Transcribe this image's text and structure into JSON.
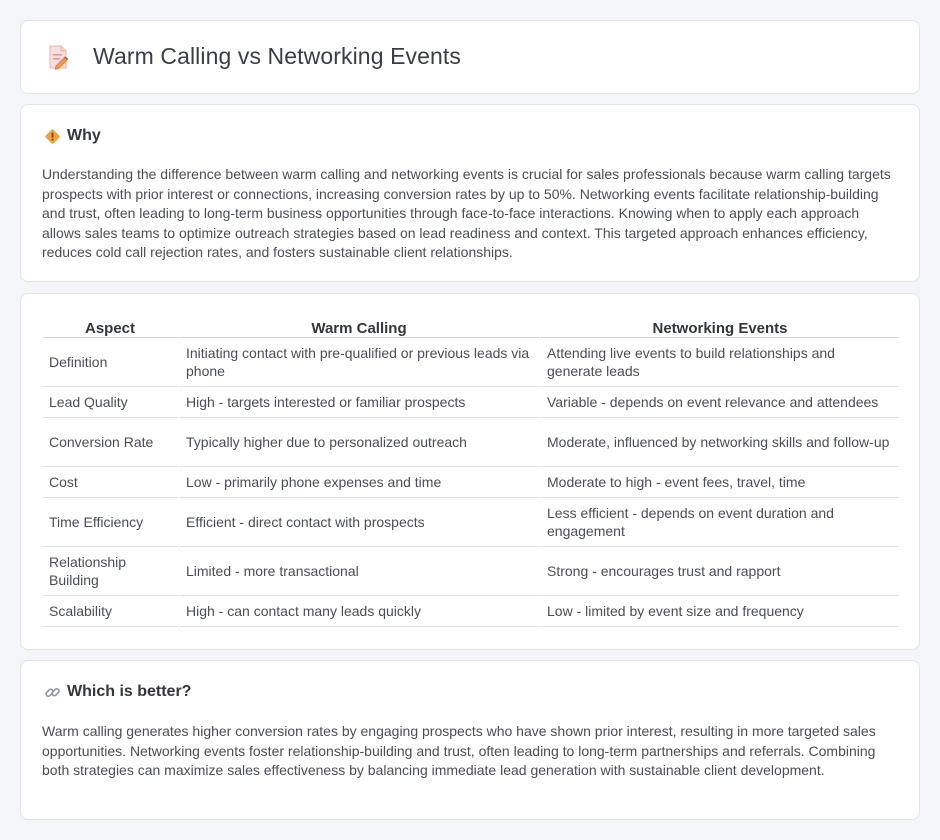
{
  "header": {
    "title": "Warm Calling vs Networking Events",
    "icon": "document-pencil-icon"
  },
  "why": {
    "title": "Why",
    "icon": "diamond-warning-icon",
    "text": "Understanding the difference between warm calling and networking events is crucial for sales professionals because warm calling targets prospects with prior interest or connections, increasing conversion rates by up to 50%. Networking events facilitate relationship-building and trust, often leading to long-term business opportunities through face-to-face interactions. Knowing when to apply each approach allows sales teams to optimize outreach strategies based on lead readiness and context. This targeted approach enhances efficiency, reduces cold call rejection rates, and fosters sustainable client relationships."
  },
  "table": {
    "headers": [
      "Aspect",
      "Warm Calling",
      "Networking Events"
    ],
    "rows": [
      [
        "Definition",
        "Initiating contact with pre-qualified or previous leads via phone",
        "Attending live events to build relationships and generate leads"
      ],
      [
        "Lead Quality",
        "High - targets interested or familiar prospects",
        "Variable - depends on event relevance and attendees"
      ],
      [
        "Conversion Rate",
        "Typically higher due to personalized outreach",
        "Moderate, influenced by networking skills and follow-up"
      ],
      [
        "Cost",
        "Low - primarily phone expenses and time",
        "Moderate to high - event fees, travel, time"
      ],
      [
        "Time Efficiency",
        "Efficient - direct contact with prospects",
        "Less efficient - depends on event duration and engagement"
      ],
      [
        "Relationship Building",
        "Limited - more transactional",
        "Strong - encourages trust and rapport"
      ],
      [
        "Scalability",
        "High - can contact many leads quickly",
        "Low - limited by event size and frequency"
      ]
    ]
  },
  "better": {
    "title": "Which is better?",
    "icon": "link-icon",
    "text": "Warm calling generates higher conversion rates by engaging prospects who have shown prior interest, resulting in more targeted sales opportunities. Networking events foster relationship-building and trust, often leading to long-term partnerships and referrals. Combining both strategies can maximize sales effectiveness by balancing immediate lead generation with sustainable client development."
  },
  "colors": {
    "background": "#f3f5f8",
    "card": "#ffffff",
    "icon_accent": "#f0a04b"
  }
}
